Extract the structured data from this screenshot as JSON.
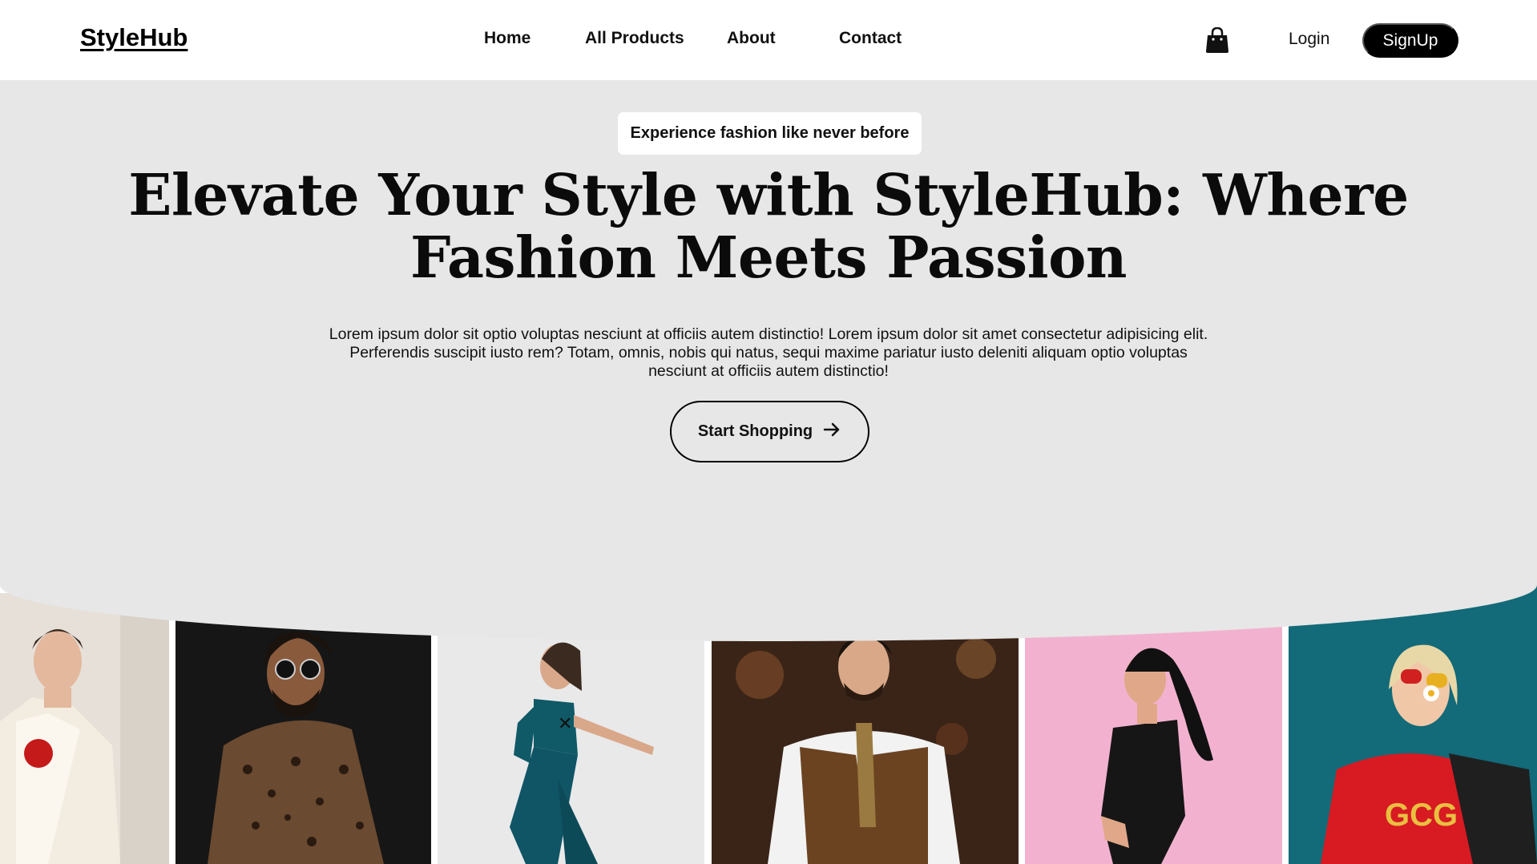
{
  "brand": {
    "name": "StyleHub"
  },
  "nav": {
    "items": [
      {
        "label": "Home"
      },
      {
        "label": "All Products"
      },
      {
        "label": "About"
      },
      {
        "label": "Contact"
      }
    ]
  },
  "header_actions": {
    "cart_icon": "shopping-bag-icon",
    "login_label": "Login",
    "signup_label": "SignUp"
  },
  "hero": {
    "badge": "Experience fashion like never before",
    "title": "Elevate Your Style with StyleHub: Where Fashion Meets Passion",
    "description": "Lorem ipsum dolor sit optio voluptas nesciunt at officiis autem distinctio! Lorem ipsum dolor sit amet consectetur adipisicing elit. Perferendis suscipit iusto rem? Totam, omnis, nobis qui natus, sequi maxime pariatur iusto deleniti aliquam optio voluptas nesciunt at officiis autem distinctio!",
    "cta_label": "Start Shopping",
    "cta_icon": "arrow-right-icon"
  },
  "gallery": {
    "photos": [
      {
        "subject": "woman in cream blazer with red flower"
      },
      {
        "subject": "man in leopard print shirt and sunglasses"
      },
      {
        "subject": "woman in teal outfit posing"
      },
      {
        "subject": "man in brown vest and tie"
      },
      {
        "subject": "woman in black dress on pink background"
      },
      {
        "subject": "woman in red shirt with sunglasses on teal background"
      }
    ]
  },
  "colors": {
    "hero_bg": "#e7e7e7",
    "primary": "#000000",
    "page_bg": "#ffffff"
  }
}
